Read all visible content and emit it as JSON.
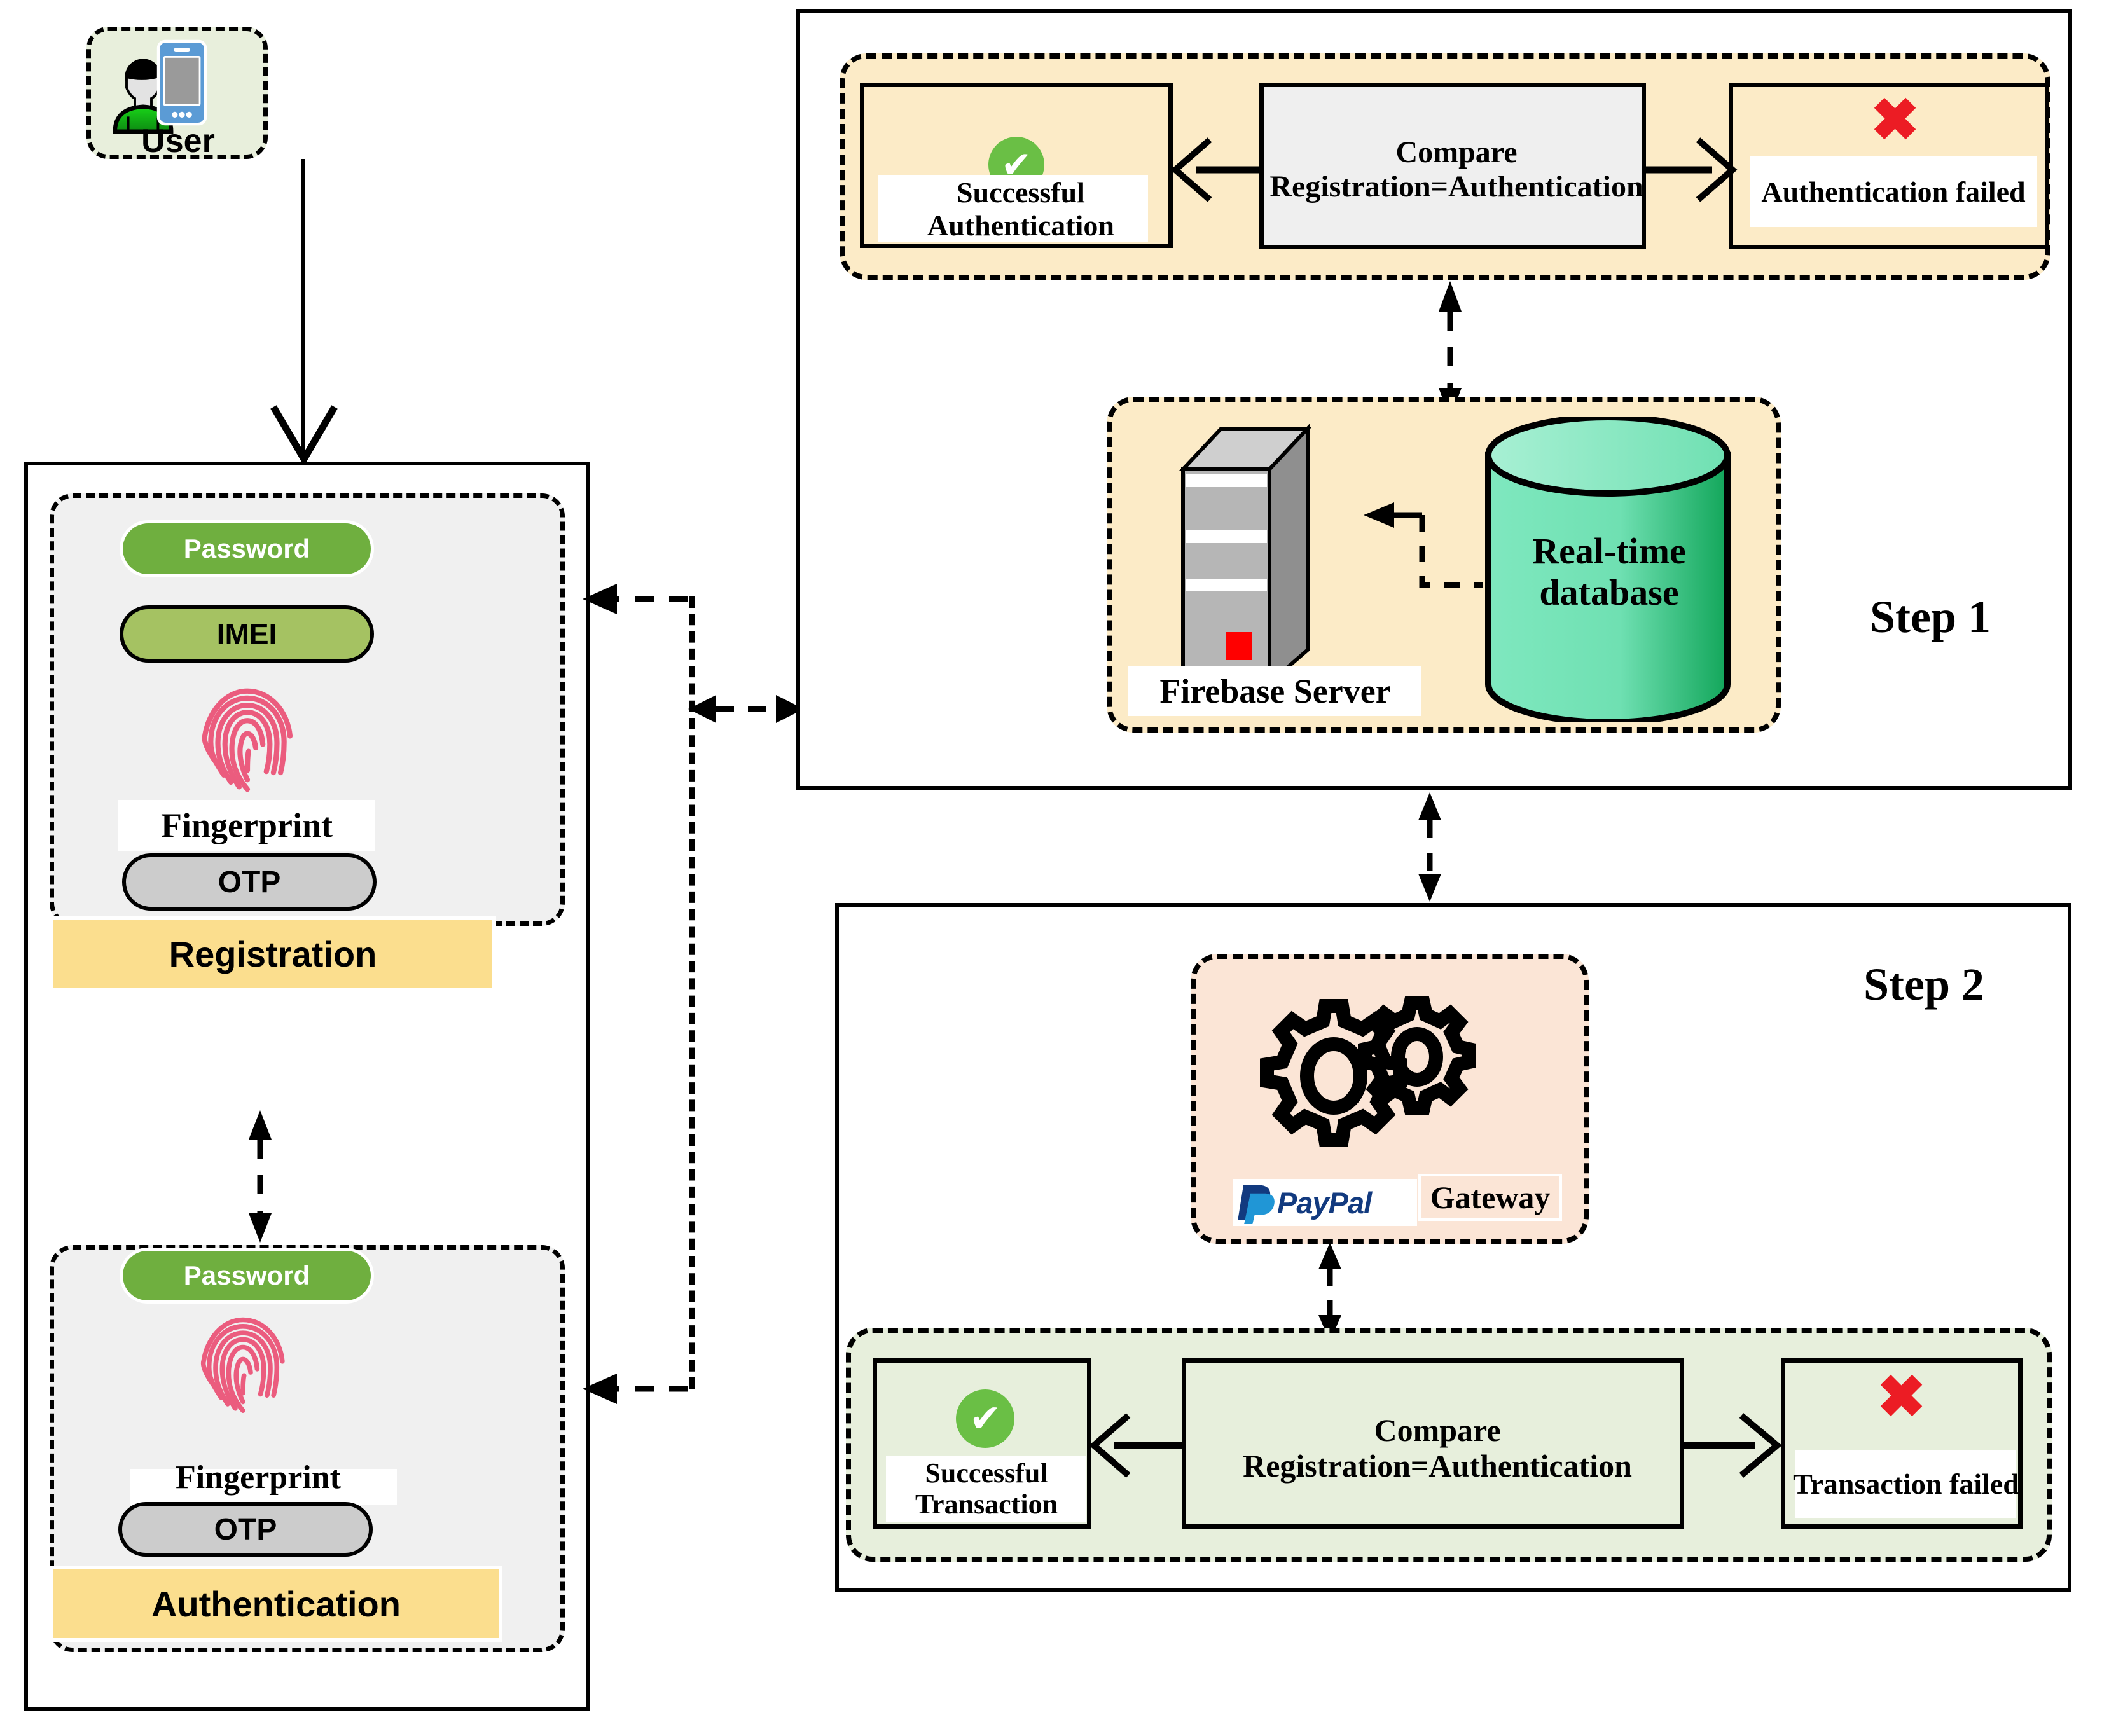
{
  "diagram": {
    "title_hidden": "Two-step authentication and transaction flow"
  },
  "user_panel": {
    "label": "User",
    "icons": [
      "user-avatar-icon",
      "smartphone-icon"
    ]
  },
  "left_panel": {
    "registration": {
      "items": [
        {
          "id": "password",
          "label": "Password",
          "style": "green-pill"
        },
        {
          "id": "imei",
          "label": "IMEI",
          "style": "olive-pill"
        },
        {
          "id": "fingerprint-icon",
          "label": "",
          "style": "icon"
        },
        {
          "id": "fingerprint",
          "label": "Fingerprint",
          "style": "plain"
        },
        {
          "id": "otp",
          "label": "OTP",
          "style": "grey-pill"
        }
      ],
      "footer_label": "Registration"
    },
    "authentication": {
      "items": [
        {
          "id": "password",
          "label": "Password",
          "style": "green-pill"
        },
        {
          "id": "fingerprint-icon",
          "label": "",
          "style": "icon"
        },
        {
          "id": "fingerprint",
          "label": "Fingerprint",
          "style": "plain"
        },
        {
          "id": "otp",
          "label": "OTP",
          "style": "grey-pill"
        }
      ],
      "footer_label": "Authentication"
    }
  },
  "step1": {
    "label": "Step 1",
    "compare": {
      "text": "Compare Registration=Authentication"
    },
    "success": {
      "text": "Successful Authentication",
      "icon": "green-check-icon"
    },
    "failure": {
      "text": "Authentication failed",
      "icon": "red-x-icon"
    },
    "server": {
      "label": "Firebase Server",
      "icon": "server-tower-icon"
    },
    "database": {
      "label": "Real-time database",
      "icon": "database-cylinder-icon"
    }
  },
  "step2": {
    "label": "Step 2",
    "gateway": {
      "brand": "PayPal",
      "label": "Gateway",
      "icon": "gears-icon"
    },
    "compare": {
      "text": "Compare Registration=Authentication"
    },
    "success": {
      "text": "Successful Transaction",
      "icon": "green-check-icon"
    },
    "failure": {
      "text": "Transaction failed",
      "icon": "red-x-icon"
    }
  },
  "colors": {
    "green_pill": "#6FAF3F",
    "olive_pill": "#A5C262",
    "grey_pill": "#CCCCCC",
    "yellow_band": "#FBDE8E",
    "panel_grey": "#F0F0F0",
    "user_green": "#E8EFDC",
    "step1_cream": "#FCEBC7",
    "step2_mint": "#E7EFDC",
    "gateway_peach": "#FBE5D6",
    "fingerprint_pink": "#EB5C7E",
    "db_green": "#7FE3B8",
    "check_green": "#6ABF45",
    "x_red": "#EC1C24",
    "paypal_dark": "#123A7F",
    "paypal_light": "#2096D6"
  }
}
